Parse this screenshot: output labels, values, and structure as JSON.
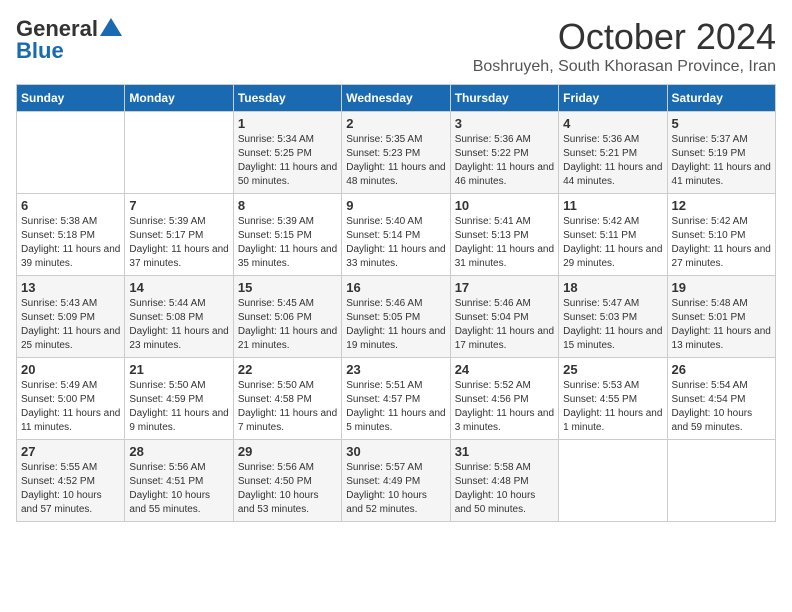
{
  "logo": {
    "line1": "General",
    "line2": "Blue"
  },
  "title": "October 2024",
  "subtitle": "Boshruyeh, South Khorasan Province, Iran",
  "days_of_week": [
    "Sunday",
    "Monday",
    "Tuesday",
    "Wednesday",
    "Thursday",
    "Friday",
    "Saturday"
  ],
  "weeks": [
    [
      {
        "day": "",
        "details": ""
      },
      {
        "day": "",
        "details": ""
      },
      {
        "day": "1",
        "details": "Sunrise: 5:34 AM\nSunset: 5:25 PM\nDaylight: 11 hours and 50 minutes."
      },
      {
        "day": "2",
        "details": "Sunrise: 5:35 AM\nSunset: 5:23 PM\nDaylight: 11 hours and 48 minutes."
      },
      {
        "day": "3",
        "details": "Sunrise: 5:36 AM\nSunset: 5:22 PM\nDaylight: 11 hours and 46 minutes."
      },
      {
        "day": "4",
        "details": "Sunrise: 5:36 AM\nSunset: 5:21 PM\nDaylight: 11 hours and 44 minutes."
      },
      {
        "day": "5",
        "details": "Sunrise: 5:37 AM\nSunset: 5:19 PM\nDaylight: 11 hours and 41 minutes."
      }
    ],
    [
      {
        "day": "6",
        "details": "Sunrise: 5:38 AM\nSunset: 5:18 PM\nDaylight: 11 hours and 39 minutes."
      },
      {
        "day": "7",
        "details": "Sunrise: 5:39 AM\nSunset: 5:17 PM\nDaylight: 11 hours and 37 minutes."
      },
      {
        "day": "8",
        "details": "Sunrise: 5:39 AM\nSunset: 5:15 PM\nDaylight: 11 hours and 35 minutes."
      },
      {
        "day": "9",
        "details": "Sunrise: 5:40 AM\nSunset: 5:14 PM\nDaylight: 11 hours and 33 minutes."
      },
      {
        "day": "10",
        "details": "Sunrise: 5:41 AM\nSunset: 5:13 PM\nDaylight: 11 hours and 31 minutes."
      },
      {
        "day": "11",
        "details": "Sunrise: 5:42 AM\nSunset: 5:11 PM\nDaylight: 11 hours and 29 minutes."
      },
      {
        "day": "12",
        "details": "Sunrise: 5:42 AM\nSunset: 5:10 PM\nDaylight: 11 hours and 27 minutes."
      }
    ],
    [
      {
        "day": "13",
        "details": "Sunrise: 5:43 AM\nSunset: 5:09 PM\nDaylight: 11 hours and 25 minutes."
      },
      {
        "day": "14",
        "details": "Sunrise: 5:44 AM\nSunset: 5:08 PM\nDaylight: 11 hours and 23 minutes."
      },
      {
        "day": "15",
        "details": "Sunrise: 5:45 AM\nSunset: 5:06 PM\nDaylight: 11 hours and 21 minutes."
      },
      {
        "day": "16",
        "details": "Sunrise: 5:46 AM\nSunset: 5:05 PM\nDaylight: 11 hours and 19 minutes."
      },
      {
        "day": "17",
        "details": "Sunrise: 5:46 AM\nSunset: 5:04 PM\nDaylight: 11 hours and 17 minutes."
      },
      {
        "day": "18",
        "details": "Sunrise: 5:47 AM\nSunset: 5:03 PM\nDaylight: 11 hours and 15 minutes."
      },
      {
        "day": "19",
        "details": "Sunrise: 5:48 AM\nSunset: 5:01 PM\nDaylight: 11 hours and 13 minutes."
      }
    ],
    [
      {
        "day": "20",
        "details": "Sunrise: 5:49 AM\nSunset: 5:00 PM\nDaylight: 11 hours and 11 minutes."
      },
      {
        "day": "21",
        "details": "Sunrise: 5:50 AM\nSunset: 4:59 PM\nDaylight: 11 hours and 9 minutes."
      },
      {
        "day": "22",
        "details": "Sunrise: 5:50 AM\nSunset: 4:58 PM\nDaylight: 11 hours and 7 minutes."
      },
      {
        "day": "23",
        "details": "Sunrise: 5:51 AM\nSunset: 4:57 PM\nDaylight: 11 hours and 5 minutes."
      },
      {
        "day": "24",
        "details": "Sunrise: 5:52 AM\nSunset: 4:56 PM\nDaylight: 11 hours and 3 minutes."
      },
      {
        "day": "25",
        "details": "Sunrise: 5:53 AM\nSunset: 4:55 PM\nDaylight: 11 hours and 1 minute."
      },
      {
        "day": "26",
        "details": "Sunrise: 5:54 AM\nSunset: 4:54 PM\nDaylight: 10 hours and 59 minutes."
      }
    ],
    [
      {
        "day": "27",
        "details": "Sunrise: 5:55 AM\nSunset: 4:52 PM\nDaylight: 10 hours and 57 minutes."
      },
      {
        "day": "28",
        "details": "Sunrise: 5:56 AM\nSunset: 4:51 PM\nDaylight: 10 hours and 55 minutes."
      },
      {
        "day": "29",
        "details": "Sunrise: 5:56 AM\nSunset: 4:50 PM\nDaylight: 10 hours and 53 minutes."
      },
      {
        "day": "30",
        "details": "Sunrise: 5:57 AM\nSunset: 4:49 PM\nDaylight: 10 hours and 52 minutes."
      },
      {
        "day": "31",
        "details": "Sunrise: 5:58 AM\nSunset: 4:48 PM\nDaylight: 10 hours and 50 minutes."
      },
      {
        "day": "",
        "details": ""
      },
      {
        "day": "",
        "details": ""
      }
    ]
  ]
}
